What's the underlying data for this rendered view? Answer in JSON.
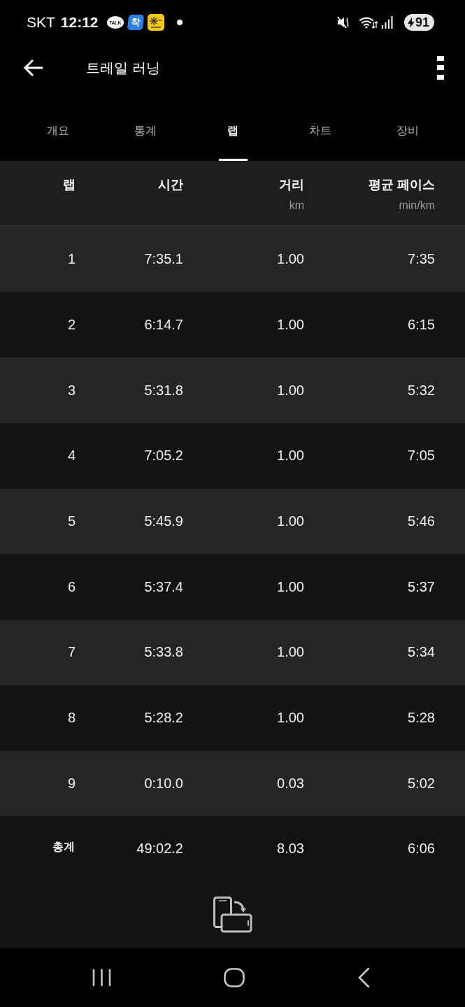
{
  "status_bar": {
    "carrier": "SKT",
    "time": "12:12",
    "notifications": [
      {
        "kind": "chat",
        "label": "TALK"
      },
      {
        "kind": "tile",
        "label": "착"
      },
      {
        "kind": "sun"
      },
      {
        "kind": "more"
      }
    ],
    "battery": "91"
  },
  "app_bar": {
    "title": "트레일 러닝"
  },
  "tabs": [
    {
      "label": "개요",
      "selected": false
    },
    {
      "label": "통계",
      "selected": false
    },
    {
      "label": "랩",
      "selected": true
    },
    {
      "label": "차트",
      "selected": false
    },
    {
      "label": "장비",
      "selected": false
    }
  ],
  "table": {
    "columns": [
      {
        "label": "랩"
      },
      {
        "label": "시간"
      },
      {
        "label": "거리",
        "unit": "km"
      },
      {
        "label": "평균 페이스",
        "unit": "min/km"
      }
    ],
    "rows": [
      [
        "1",
        "7:35.1",
        "1.00",
        "7:35"
      ],
      [
        "2",
        "6:14.7",
        "1.00",
        "6:15"
      ],
      [
        "3",
        "5:31.8",
        "1.00",
        "5:32"
      ],
      [
        "4",
        "7:05.2",
        "1.00",
        "7:05"
      ],
      [
        "5",
        "5:45.9",
        "1.00",
        "5:46"
      ],
      [
        "6",
        "5:37.4",
        "1.00",
        "5:37"
      ],
      [
        "7",
        "5:33.8",
        "1.00",
        "5:34"
      ],
      [
        "8",
        "5:28.2",
        "1.00",
        "5:28"
      ],
      [
        "9",
        "0:10.0",
        "0.03",
        "5:02"
      ]
    ],
    "total": [
      "총계",
      "49:02.2",
      "8.03",
      "6:06"
    ]
  }
}
